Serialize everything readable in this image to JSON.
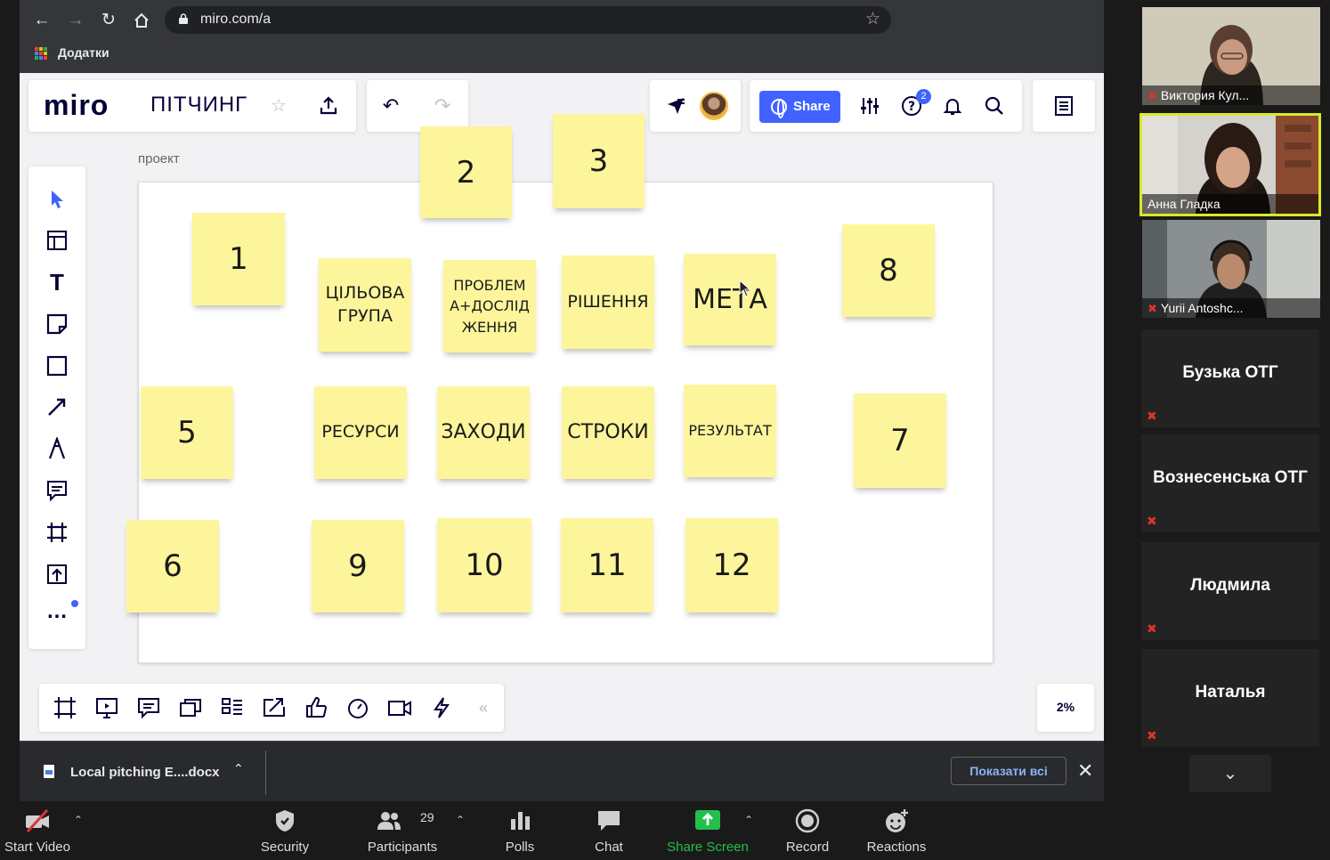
{
  "browser": {
    "url": "miro.com/a",
    "bookmarks_label": "Додатки"
  },
  "miro": {
    "logo": "miro",
    "board_title": "ПІТЧИНГ",
    "share_label": "Share",
    "help_badge": "2",
    "frame_label": "проект",
    "zoom_level": "2%"
  },
  "stickies": [
    {
      "text": "2"
    },
    {
      "text": "3"
    },
    {
      "text": "1"
    },
    {
      "text": "ЦІЛЬОВА ГРУПА"
    },
    {
      "text": "ПРОБЛЕМ А+ДОСЛІД ЖЕННЯ"
    },
    {
      "text": "РІШЕННЯ"
    },
    {
      "text": "МЕТА"
    },
    {
      "text": "8"
    },
    {
      "text": "5"
    },
    {
      "text": "РЕСУРСИ"
    },
    {
      "text": "ЗАХОДИ"
    },
    {
      "text": "СТРОКИ"
    },
    {
      "text": "РЕЗУЛЬТАТ"
    },
    {
      "text": "7"
    },
    {
      "text": "6"
    },
    {
      "text": "9"
    },
    {
      "text": "10"
    },
    {
      "text": "11"
    },
    {
      "text": "12"
    }
  ],
  "download": {
    "file_name": "Local pitching E....docx",
    "show_all": "Показати всі"
  },
  "zoom_toolbar": {
    "start_video": "Start Video",
    "security": "Security",
    "participants": "Participants",
    "participants_count": "29",
    "polls": "Polls",
    "chat": "Chat",
    "share_screen": "Share Screen",
    "record": "Record",
    "reactions": "Reactions"
  },
  "video_participants": [
    {
      "name": "Виктория Кул..."
    },
    {
      "name": "Анна Гладка"
    },
    {
      "name": "Yurii Antoshc..."
    }
  ],
  "tile_participants": [
    {
      "name": "Бузька ОТГ"
    },
    {
      "name": "Вознесенська ОТГ"
    },
    {
      "name": "Людмила"
    },
    {
      "name": "Наталья"
    }
  ],
  "colors": {
    "miro_blue": "#4262ff",
    "sticky_yellow": "#fdf59b",
    "share_screen_green": "#22c04a",
    "active_speaker": "#d8e82a",
    "mic_muted_red": "#e0322e"
  }
}
